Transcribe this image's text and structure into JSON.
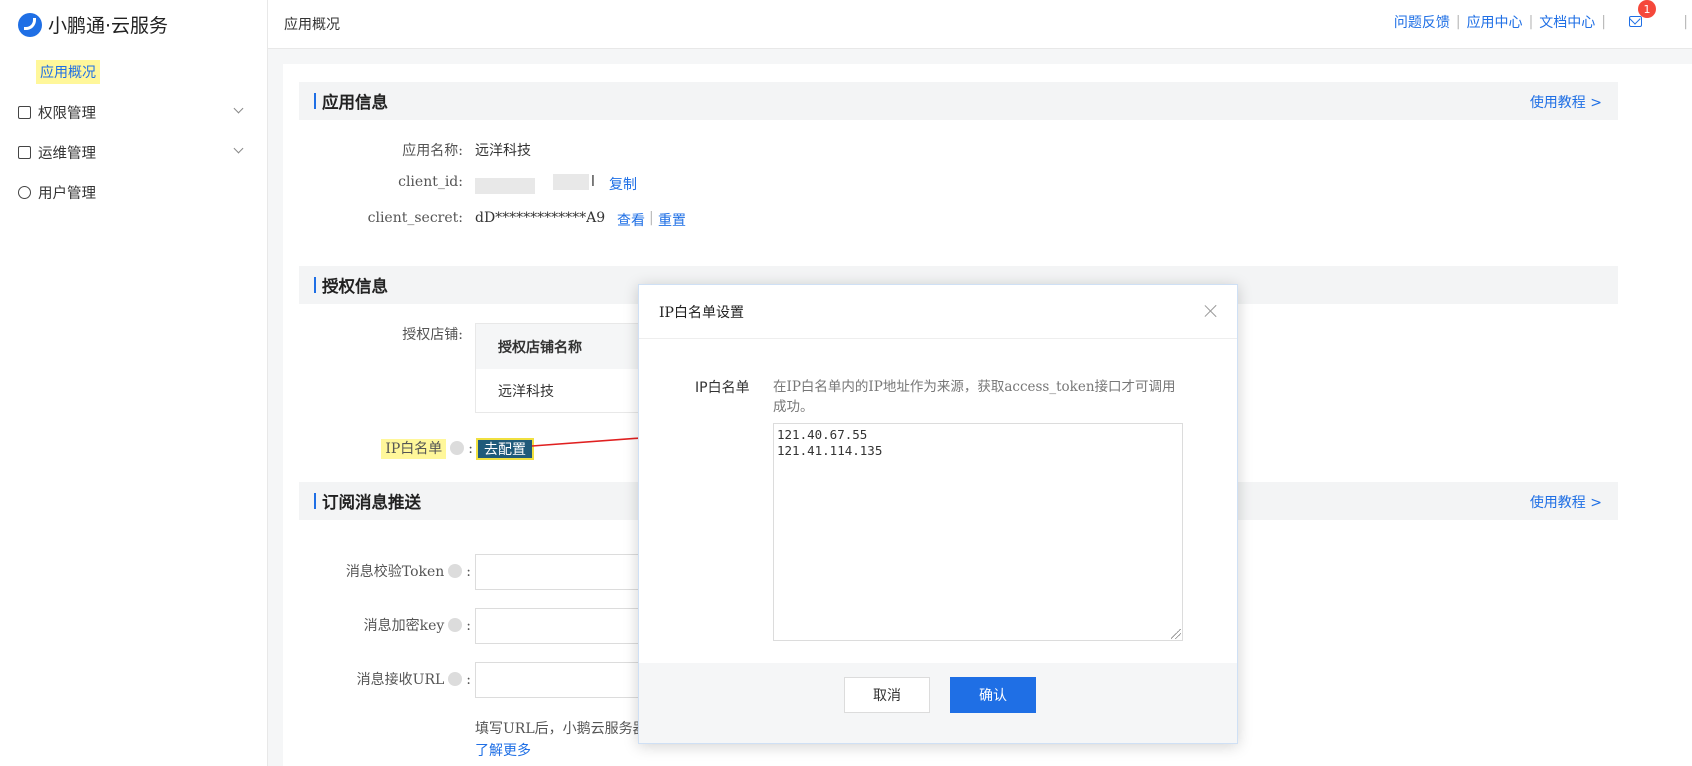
{
  "logo": {
    "text": "小鹏通·云服务"
  },
  "sidebar": {
    "active": "应用概况",
    "items": [
      {
        "label": "权限管理"
      },
      {
        "label": "运维管理"
      },
      {
        "label": "用户管理"
      }
    ]
  },
  "header": {
    "breadcrumb": "应用概况",
    "links": [
      "问题反馈",
      "应用中心",
      "文档中心"
    ],
    "badge_count": "1"
  },
  "app_info": {
    "title": "应用信息",
    "tutorial": "使用教程 >",
    "name_label": "应用名称:",
    "name_value": "远洋科技",
    "client_id_label": "client_id:",
    "client_id_tail": "l",
    "copy": "复制",
    "secret_label": "client_secret:",
    "secret_value": "dD*************A9",
    "view": "查看",
    "reset": "重置",
    "sep": "|"
  },
  "auth_info": {
    "title": "授权信息",
    "store_label": "授权店铺:",
    "table_header": "授权店铺名称",
    "table_row": "远洋科技",
    "ip_label": "IP白名单",
    "colon": ":",
    "configure": "去配置"
  },
  "subscribe": {
    "title": "订阅消息推送",
    "tutorial": "使用教程 >",
    "token_label": "消息校验Token",
    "key_label": "消息加密key",
    "url_label": "消息接收URL",
    "colon": ":",
    "tip": "填写URL后，小鹅云服务器",
    "more": "了解更多"
  },
  "modal": {
    "title": "IP白名单设置",
    "field_label": "IP白名单",
    "description": "在IP白名单内的IP地址作为来源，获取access_token接口才可调用成功。",
    "textarea_value": "121.40.67.55\n121.41.114.135",
    "cancel": "取消",
    "confirm": "确认"
  },
  "colors": {
    "accent": "#1f6fe5",
    "highlight": "#fff79a",
    "arrow": "#e02020"
  }
}
